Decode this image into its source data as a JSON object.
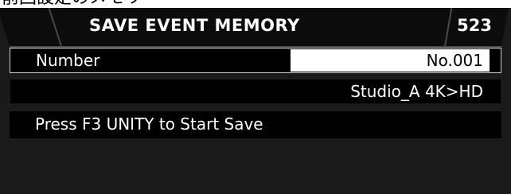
{
  "header_fragment": "前回設定のメモリ",
  "title_bar": {
    "title": "SAVE EVENT MEMORY",
    "code": "523"
  },
  "number_row": {
    "label": "Number",
    "value": "No.001"
  },
  "event_name": "Studio_A 4K>HD",
  "message": "Press F3 UNITY to Start Save"
}
